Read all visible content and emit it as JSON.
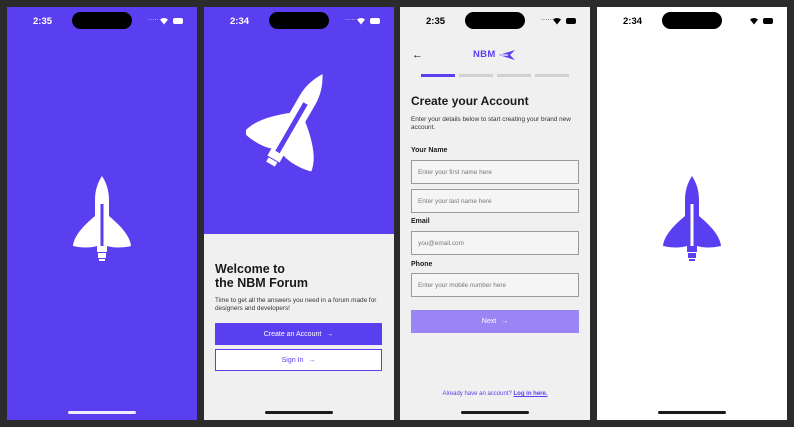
{
  "colors": {
    "brand": "#5a3ff0",
    "brand_light": "#9b85f5",
    "screen_bg": "#f0f0f0"
  },
  "screen1": {
    "time": "2:35",
    "signal": "....."
  },
  "screen2": {
    "time": "2:34",
    "signal": ".....",
    "welcome_line1": "Welcome to",
    "welcome_line2": "the NBM Forum",
    "description": "Time to get all the answers you need in a forum made for designers and developers!",
    "create_account_label": "Create an Account",
    "sign_in_label": "Sign In"
  },
  "screen3": {
    "time": "2:35",
    "signal": ".....",
    "back_icon": "arrow-left-icon",
    "logo_text": "NBM",
    "steps": [
      true,
      false,
      false,
      false
    ],
    "title": "Create your Account",
    "subtitle": "Enter your details below to start creating your brand new account.",
    "name_label": "Your Name",
    "first_name_placeholder": "Enter your first name here",
    "last_name_placeholder": "Enter your last name here",
    "email_label": "Email",
    "email_placeholder": "you@email.com",
    "phone_label": "Phone",
    "phone_placeholder": "Enter your mobile number here",
    "next_label": "Next",
    "already_text": "Already have an account?",
    "login_link": "Log in here."
  },
  "screen4": {
    "time": "2:34"
  }
}
